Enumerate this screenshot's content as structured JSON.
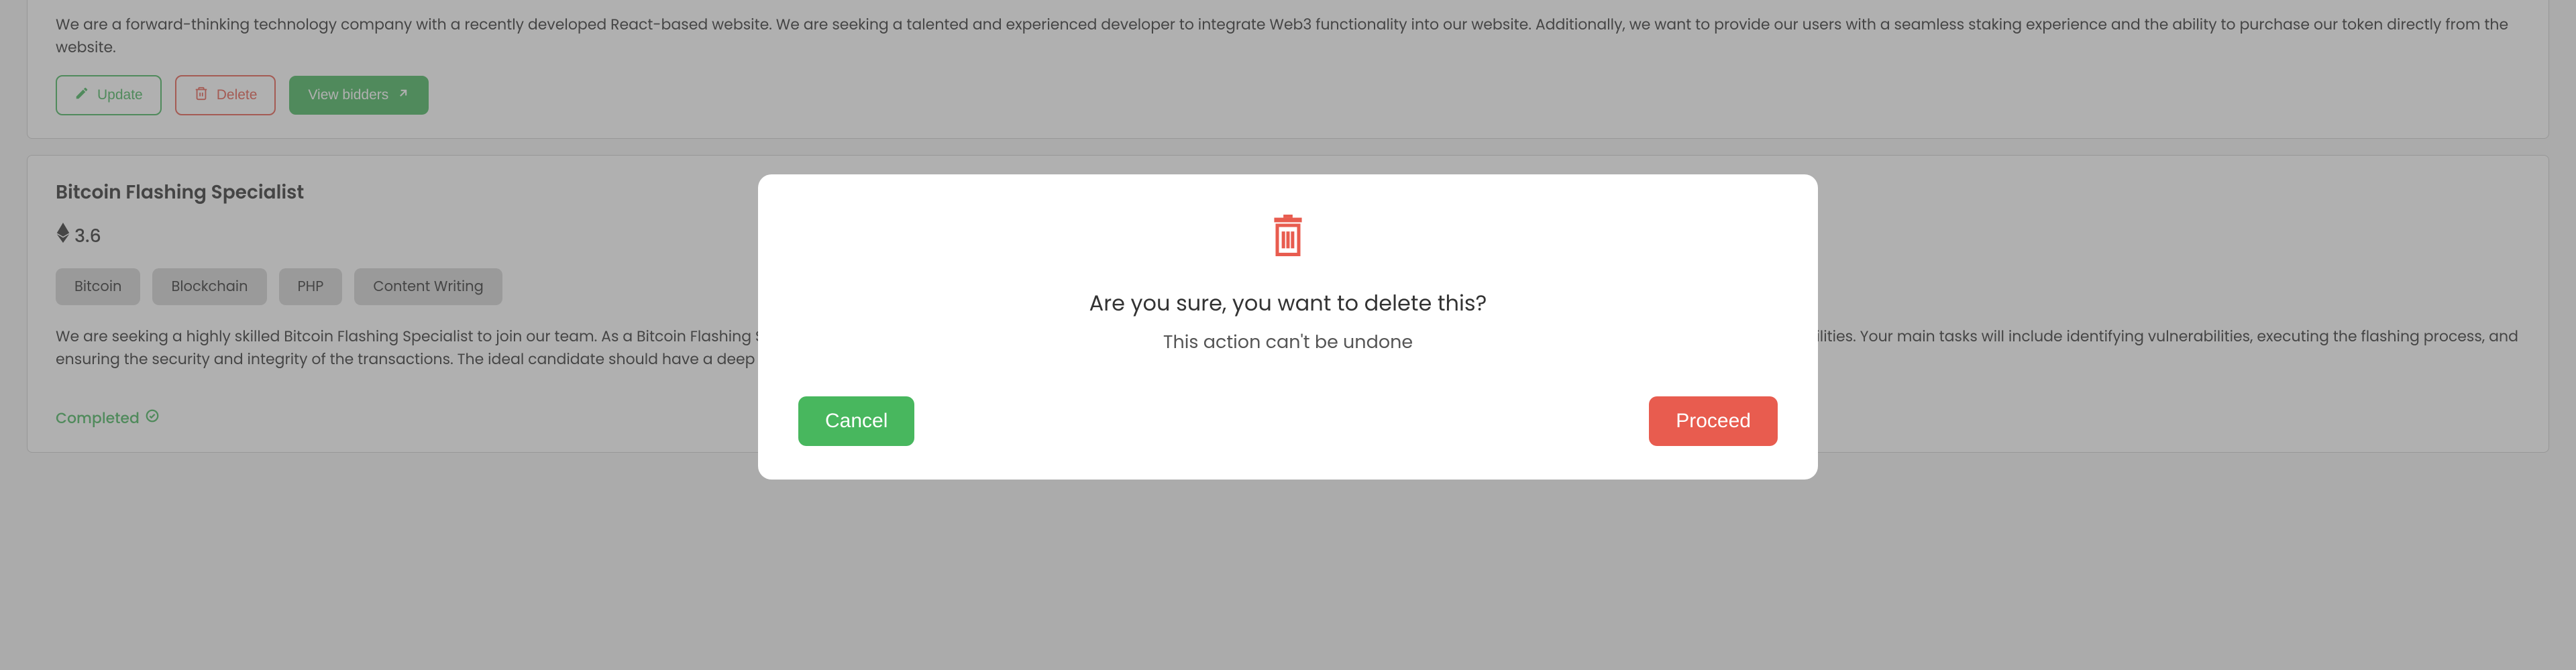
{
  "cards": [
    {
      "description": "We are a forward-thinking technology company with a recently developed React-based website. We are seeking a talented and experienced developer to integrate Web3 functionality into our website. Additionally, we want to provide our users with a seamless staking experience and the ability to purchase our token directly from the website.",
      "buttons": {
        "update": "Update",
        "delete": "Delete",
        "view": "View bidders"
      }
    },
    {
      "title": "Bitcoin Flashing Specialist",
      "rating": "3.6",
      "tags": [
        "Bitcoin",
        "Blockchain",
        "PHP",
        "Content Writing"
      ],
      "description": "We are seeking a highly skilled Bitcoin Flashing Specialist to join our team. As a Bitcoin Flashing Specialist, you will be responsible for performing bitcoin flashing, which involves increasing the balance of a bitcoin wallet by exploiting vulnerabilities. Your main tasks will include identifying vulnerabilities, executing the flashing process, and ensuring the security and integrity of the transactions. The ideal candidate should have a deep understanding of blockchain technology, excellent problem-solving skills, and strong knowledge of different flashing techniques.",
      "status": "Completed"
    }
  ],
  "modal": {
    "question": "Are you sure, you want to delete this?",
    "note": "This action can't be undone",
    "cancel": "Cancel",
    "proceed": "Proceed"
  }
}
